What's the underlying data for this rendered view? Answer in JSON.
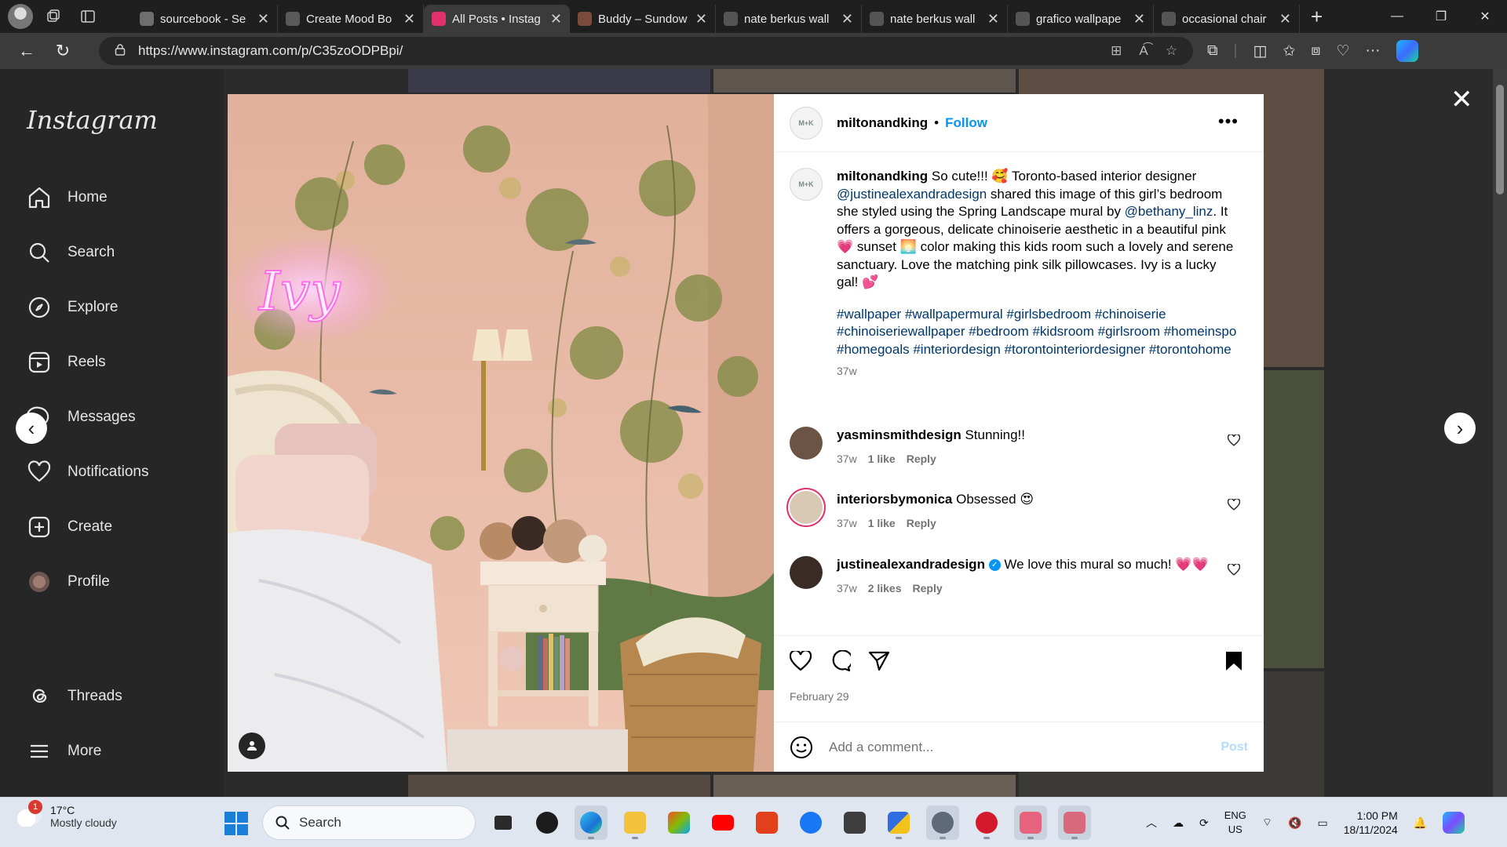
{
  "browser": {
    "tabs": [
      {
        "title": "sourcebook - Se",
        "fav_color": "#6e6e6e",
        "active": false
      },
      {
        "title": "Create Mood Bo",
        "fav_color": "#5a5a5a",
        "active": false
      },
      {
        "title": "All Posts • Instag",
        "fav_color": "#e1306c",
        "active": true
      },
      {
        "title": "Buddy – Sundow",
        "fav_color": "#7a4a3a",
        "active": false
      },
      {
        "title": "nate berkus wall",
        "fav_color": "#555555",
        "active": false
      },
      {
        "title": "nate berkus wall",
        "fav_color": "#555555",
        "active": false
      },
      {
        "title": "grafico wallpape",
        "fav_color": "#555555",
        "active": false
      },
      {
        "title": "occasional chair",
        "fav_color": "#555555",
        "active": false
      }
    ],
    "url": "https://www.instagram.com/p/C35zoODPBpi/"
  },
  "sidebar": {
    "logo": "Instagram",
    "items": [
      {
        "label": "Home",
        "icon": "home-icon"
      },
      {
        "label": "Search",
        "icon": "search-icon"
      },
      {
        "label": "Explore",
        "icon": "compass-icon"
      },
      {
        "label": "Reels",
        "icon": "reels-icon"
      },
      {
        "label": "Messages",
        "icon": "messenger-icon"
      },
      {
        "label": "Notifications",
        "icon": "heart-icon"
      },
      {
        "label": "Create",
        "icon": "plus-square-icon"
      },
      {
        "label": "Profile",
        "icon": "profile-avatar"
      },
      {
        "label": "Threads",
        "icon": "threads-icon"
      },
      {
        "label": "More",
        "icon": "menu-icon"
      }
    ]
  },
  "post": {
    "author": "miltonandking",
    "author_avatar_text": "M+K",
    "follow_label": "Follow",
    "dot": "•",
    "caption": {
      "username": "miltonandking",
      "t1": " So cute!!! 🥰 Toronto-based interior designer ",
      "mention1": "@justinealexandradesign",
      "t2": " shared this image of this girl’s bedroom she styled using the Spring Landscape mural by ",
      "mention2": "@bethany_linz",
      "t3": ". It offers a gorgeous, delicate chinoiserie aesthetic in a beautiful pink 💗 sunset 🌅 color making this kids room such a lovely and serene sanctuary. Love the matching pink silk pillowcases. Ivy is a lucky gal! 💕",
      "hashtags": "#wallpaper #wallpapermural #girlsbedroom #chinoiserie #chinoiseriewallpaper #bedroom #kidsroom #girlsroom #homeinspo #homegoals #interiordesign #torontointeriordesigner #torontohome",
      "age": "37w"
    },
    "comments": [
      {
        "username": "yasminsmithdesign",
        "text": " Stunning!!",
        "age": "37w",
        "likes": "1 like",
        "reply": "Reply",
        "verified": false,
        "avatar_color": "#6b5444"
      },
      {
        "username": "interiorsbymonica",
        "text": " Obsessed 😍",
        "age": "37w",
        "likes": "1 like",
        "reply": "Reply",
        "verified": false,
        "avatar_color": "#d9c8b4"
      },
      {
        "username": "justinealexandradesign",
        "text": " We love this mural so much! 💗💗",
        "age": "37w",
        "likes": "2 likes",
        "reply": "Reply",
        "verified": true,
        "avatar_color": "#3a2c24"
      }
    ],
    "date": "February 29",
    "comment_placeholder": "Add a comment...",
    "post_label": "Post",
    "photo_neon_text": "Ivy"
  },
  "taskbar": {
    "weather_temp": "17°C",
    "weather_cond": "Mostly cloudy",
    "weather_badge": "1",
    "search_label": "Search",
    "lang_line1": "ENG",
    "lang_line2": "US",
    "time": "1:00 PM",
    "date": "18/11/2024"
  }
}
